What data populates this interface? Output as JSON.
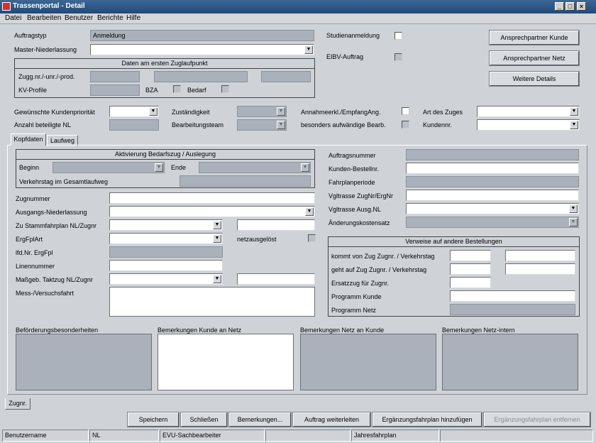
{
  "window": {
    "title": "Trassenportal - Detail",
    "controls": {
      "minimize": "_",
      "maximize": "□",
      "close": "×"
    }
  },
  "menu": {
    "items": [
      "Datei",
      "Bearbeiten",
      "Benutzer",
      "Berichte",
      "Hilfe"
    ]
  },
  "header": {
    "auftragstyp_label": "Auftragstyp",
    "auftragstyp_value": "Anmeldung",
    "master_label": "Master-Niederlassung",
    "studien_label": "Studienanmeldung",
    "eibv_label": "EIBV-Auftrag",
    "zuglauf_group_title": "Daten am ersten Zuglaufpunkt",
    "zugg_label": "Zugg.nr./-unr./-prod.",
    "kv_label": "KV-Profile",
    "bza_label": "BZA",
    "bedarf_label": "Bedarf",
    "btn_kunde": "Ansprechpartner Kunde",
    "btn_netz": "Ansprechpartner Netz",
    "btn_details": "Weitere Details"
  },
  "mid": {
    "prioritaet_label": "Gewünschte Kundenpriorität",
    "anzahl_nl_label": "Anzahl beteiligte NL",
    "zustaendigkeit_label": "Zuständigkeit",
    "team_label": "Bearbeitungsteam",
    "annahme_label": "Annahmeerkl./EmpfangAng.",
    "aufwaendig_label": "besonders aufwändige Bearb.",
    "art_label": "Art des Zuges",
    "kundennr_label": "Kundennr."
  },
  "tabs": {
    "kopfdaten": "Kopfdaten",
    "laufweg": "Laufweg"
  },
  "kopf": {
    "aktivierung_title": "Aktivierung Bedarfszug / Auslegung",
    "beginn_label": "Beginn",
    "ende_label": "Ende",
    "verkehrstag_label": "Verkehrstag im Gesamtlaufweg",
    "zugnummer_label": "Zugnummer",
    "ausgangs_label": "Ausgangs-Niederlassung",
    "stammfahrplan_label": "Zu Stammfahrplan NL/Zugnr",
    "ergfplart_label": "ErgFplArt",
    "netzausgeloest_label": "netzausgelöst",
    "lfdnr_label": "lfd.Nr. ErgFpl",
    "linie_label": "Linennummer",
    "massgeb_label": "Maßgeb. Taktzug NL/Zugnr",
    "mess_label": "Mess-/Versuchsfahrt",
    "auftragsnummer_label": "Auftragsnummer",
    "bestellnr_label": "Kunden-Bestellnr.",
    "fahrplanperiode_label": "Fahrplanperiode",
    "vgltrasse_label": "Vgltrasse ZugNr/ErgNr",
    "vgltrasse_nl_label": "Vgltrasse Ausg.NL",
    "aenderung_label": "Änderungskostensatz",
    "verweise_title": "Verweise auf andere Bestellungen",
    "kommt_label": "kommt von Zug  Zugnr. / Verkehrstag",
    "geht_label": "geht auf Zug  Zugnr. / Verkehrstag",
    "ersatz_label": "Ersatzzug für Zugnr.",
    "prog_kunde_label": "Programm Kunde",
    "prog_netz_label": "Programm Netz"
  },
  "remarks": {
    "befoerderung": "Beförderungsbesonderheiten",
    "kunde_netz": "Bemerkungen Kunde an Netz",
    "netz_kunde": "Bemerkungen Netz an Kunde",
    "netz_intern": "Bemerkungen Netz-intern"
  },
  "bottom_tab": "Zugnr.",
  "buttons": {
    "speichern": "Speichern",
    "schliessen": "Schließen",
    "bemerkungen": "Bemerkungen...",
    "weiterleiten": "Auftrag weiterleiten",
    "hinzufuegen": "Ergänzungsfahrplan hinzufügen",
    "entfernen": "Ergänzungsfahrplan entfernen"
  },
  "status": {
    "benutzer": "Benutzername",
    "nl": "NL",
    "evu": "EVU-Sachbearbeiter",
    "jahr": "Jahresfahrplan"
  }
}
